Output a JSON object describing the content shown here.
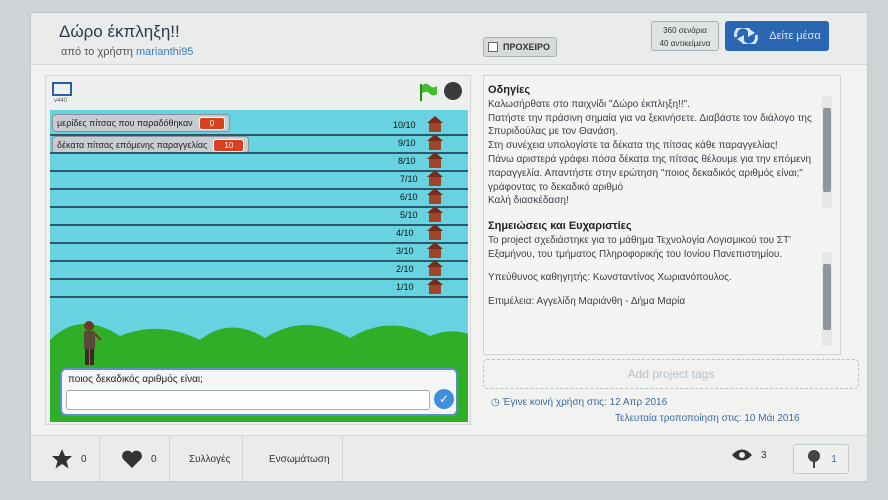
{
  "header": {
    "title": "Δώρο έκπληξη!!",
    "byline_prefix": "από το χρήστη",
    "author": "marianthi95",
    "draft_label": "ΠΡΟΧΕΙΡΟ",
    "scripts_count": "360 σενάρια",
    "sprites_count": "40 αντικείμενα",
    "see_inside_label": "Δείτε μέσα"
  },
  "stage": {
    "version_label": "v440",
    "monitors": [
      {
        "label": "μερίδες πίτσας που παραδόθηκαν",
        "value": "0"
      },
      {
        "label": "δέκατα πίτσας επόμενης παραγγελίας",
        "value": "10"
      }
    ],
    "shelf_labels": [
      "10/10",
      "9/10",
      "8/10",
      "7/10",
      "6/10",
      "5/10",
      "4/10",
      "3/10",
      "2/10",
      "1/10"
    ],
    "question": "ποιος δεκαδικός αριθμός είναι;",
    "answer_value": ""
  },
  "instructions": {
    "heading": "Οδηγίες",
    "lines": [
      "Καλωσήρθατε στο παιχνίδι \"Δώρο έκπληξη!!\".",
      "Πατήστε την πράσινη σημαία για να ξεκινήσετε. Διαβάστε τον διάλογο της Σπυριδούλας με τον Θανάση.",
      "Στη συνέχεια υπολογίστε τα δέκατα της πίτσας κάθε παραγγελίας!",
      "Πάνω αριστερά γράφει πόσα δέκατα της πίτσας θέλουμε για την επόμενη παραγγελία. Απαντήστε στην ερώτηση \"ποιος δεκαδικός αριθμός είναι;\" γράφοντας το δεκαδικό αριθμό",
      "Καλή διασκέδαση!"
    ]
  },
  "notes": {
    "heading": "Σημειώσεις και Ευχαριστίες",
    "paragraphs": [
      "Το project σχεδιάστηκε για το μάθημα Τεχνολογία Λογισμικού του ΣΤ' Εξαμήνου, του τμήματος Πληροφορικής του Ιονίου Πανεπιστημίου.",
      "Υπεύθυνος καθηγητής: Κωνσταντίνος Χωριανόπουλος.",
      "Επιμέλεια: Αγγελίδη Μαριάνθη - Δήμα Μαρία"
    ]
  },
  "tags_placeholder": "Add project tags",
  "shared_text": "Έγινε κοινή χρήση στις: 12 Απρ 2016",
  "modified_text": "Τελευταία τροποποίηση στις: 10 Μάι 2016",
  "footer": {
    "favorites_count": "0",
    "loves_count": "0",
    "collections_label": "Συλλογές",
    "embed_label": "Ενσωμάτωση",
    "views_count": "3",
    "remixes_count": "1"
  },
  "colors": {
    "accent": "#2a66b2",
    "stage_sky": "#67d2e0",
    "hills": "#2fae27",
    "monitor_value": "#d8401e"
  }
}
